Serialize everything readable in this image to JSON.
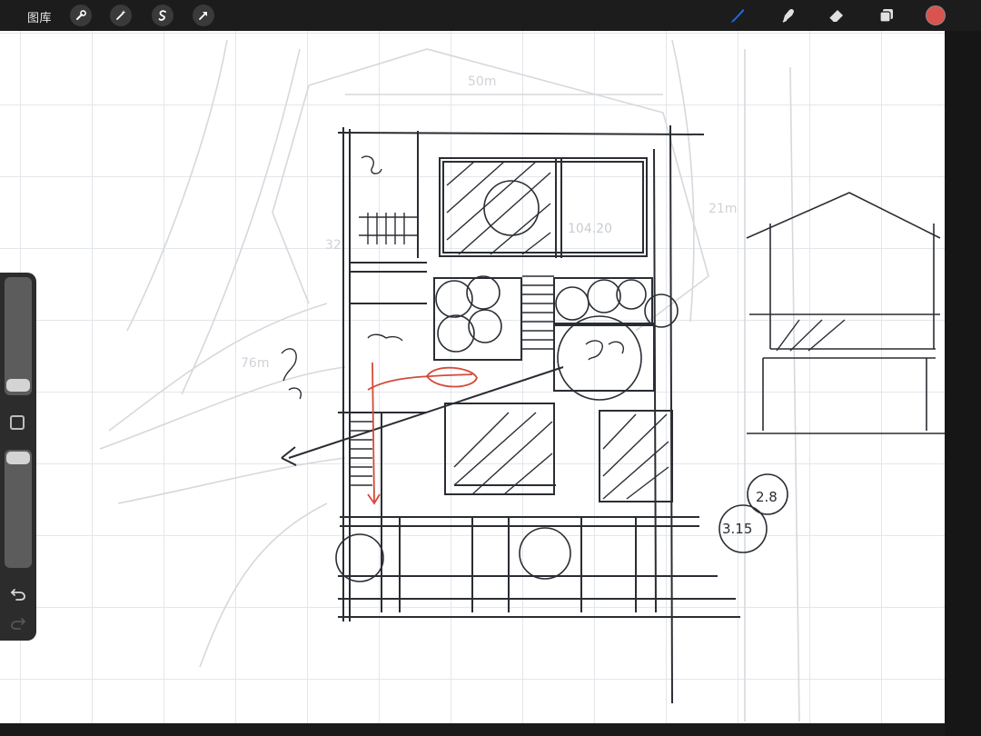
{
  "topbar": {
    "gallery_label": "图库",
    "left_tools": [
      "wrench-icon",
      "magic-wand-icon",
      "selection-icon",
      "transform-arrow-icon"
    ],
    "right_tools": [
      "brush-icon",
      "smudge-icon",
      "eraser-icon",
      "layers-icon"
    ],
    "brush_color": "#1f6fe0",
    "current_color": "#d9534f"
  },
  "sidebar": {
    "brush_size_level": 0.74,
    "opacity_level": 0.0,
    "tools": [
      "modify-button",
      "undo-icon",
      "redo-icon"
    ]
  },
  "canvas": {
    "annotations": {
      "dim_width": "50m",
      "dim_right": "21m",
      "dim_left": "32",
      "dim_left2": "76m",
      "area_label": "104.20",
      "elev1": "2.8",
      "elev2": "3.15"
    }
  }
}
